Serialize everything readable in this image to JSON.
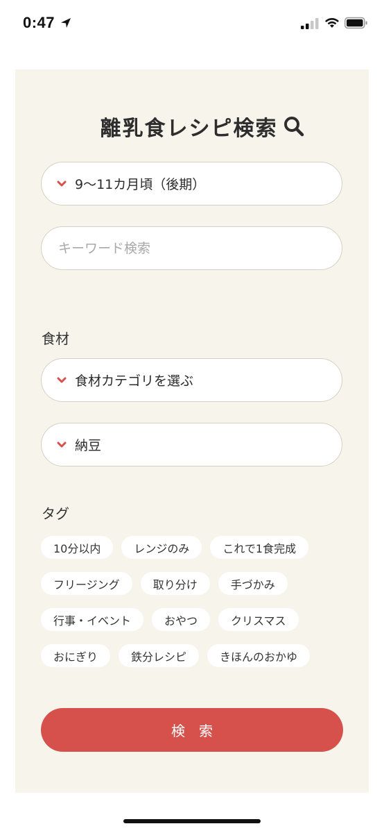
{
  "status_bar": {
    "time": "0:47"
  },
  "header": {
    "title": "離乳食レシピ検索"
  },
  "filters": {
    "age_select_value": "9〜11カ月頃（後期）",
    "keyword_placeholder": "キーワード検索"
  },
  "ingredients": {
    "label": "食材",
    "category_select_value": "食材カテゴリを選ぶ",
    "ingredient_select_value": "納豆"
  },
  "tags": {
    "label": "タグ",
    "rows": [
      [
        "10分以内",
        "レンジのみ",
        "これで1食完成"
      ],
      [
        "フリージング",
        "取り分け",
        "手づかみ"
      ],
      [
        "行事・イベント",
        "おやつ",
        "クリスマス"
      ],
      [
        "おにぎり",
        "鉄分レシピ",
        "きほんのおかゆ"
      ]
    ]
  },
  "actions": {
    "search_label": "検索"
  },
  "colors": {
    "accent": "#d6514b",
    "panel_bg": "#f7f4ec",
    "field_border": "#d6d0c4"
  },
  "icons": {
    "title": "magnifier-icon",
    "dropdown": "chevron-down-icon"
  }
}
